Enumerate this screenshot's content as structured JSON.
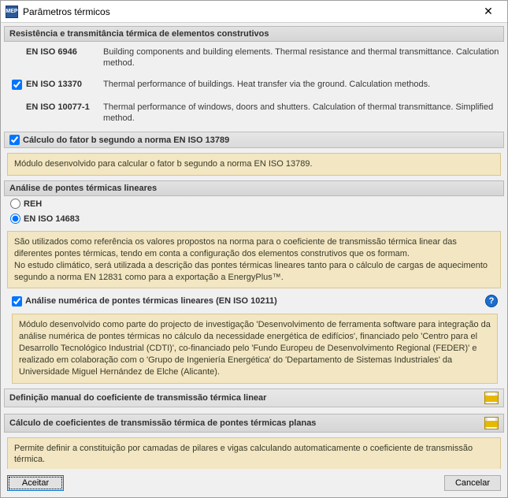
{
  "window": {
    "title": "Parâmetros térmicos"
  },
  "section1": {
    "header": "Resistência e transmitância térmica de elementos construtivos",
    "rows": [
      {
        "checked": false,
        "label": "EN ISO 6946",
        "desc": "Building components and building elements. Thermal resistance and thermal transmittance. Calculation method."
      },
      {
        "checked": true,
        "label": "EN ISO 13370",
        "desc": "Thermal performance of buildings. Heat transfer via the ground. Calculation methods."
      },
      {
        "checked": false,
        "label": "EN ISO 10077-1",
        "desc": "Thermal performance of windows, doors and shutters. Calculation of thermal transmittance. Simplified method."
      }
    ]
  },
  "factorB": {
    "header": "Cálculo do fator b segundo a norma EN ISO 13789",
    "checked": true,
    "note": "Módulo desenvolvido para calcular o fator b segundo a norma EN ISO 13789."
  },
  "section3": {
    "header": "Análise de pontes térmicas lineares",
    "radios": {
      "reh": "REH",
      "eniso14683": "EN ISO 14683",
      "selected": "eniso14683"
    },
    "note": "São utilizados como referência os valores propostos na norma para o coeficiente de transmissão térmica linear das diferentes pontes térmicas, tendo em conta a configuração dos elementos construtivos que os formam.\nNo estudo climático, será utilizada a descrição das pontes térmicas lineares tanto para o cálculo de cargas de aquecimento segundo a norma EN 12831 como para a exportação a EnergyPlus™.",
    "numeric": {
      "checked": true,
      "label": "Análise numérica de pontes térmicas lineares (EN ISO 10211)",
      "note": "Módulo desenvolvido como parte do projecto de investigação 'Desenvolvimento de ferramenta software para integração da análise numérica de pontes térmicas no cálculo da necessidade energética de edifícios', financiado pelo 'Centro para el Desarrollo Tecnológico Industrial (CDTI)', co-financiado pelo 'Fundo Europeu de Desenvolvimento Regional (FEDER)' e realizado em colaboração com o 'Grupo de Ingeniería Energética' do 'Departamento de Sistemas Industriales' da Universidade Miguel Hernández de Elche (Alicante)."
    },
    "manual": {
      "label": "Definição manual do coeficiente de transmissão térmica linear"
    }
  },
  "section4": {
    "header": "Cálculo de coeficientes de transmissão térmica de pontes térmicas planas",
    "note": "Permite definir a constituição por camadas de pilares e vigas calculando automaticamente o coeficiente de transmissão térmica."
  },
  "buttons": {
    "accept": "Aceitar",
    "cancel": "Cancelar"
  }
}
